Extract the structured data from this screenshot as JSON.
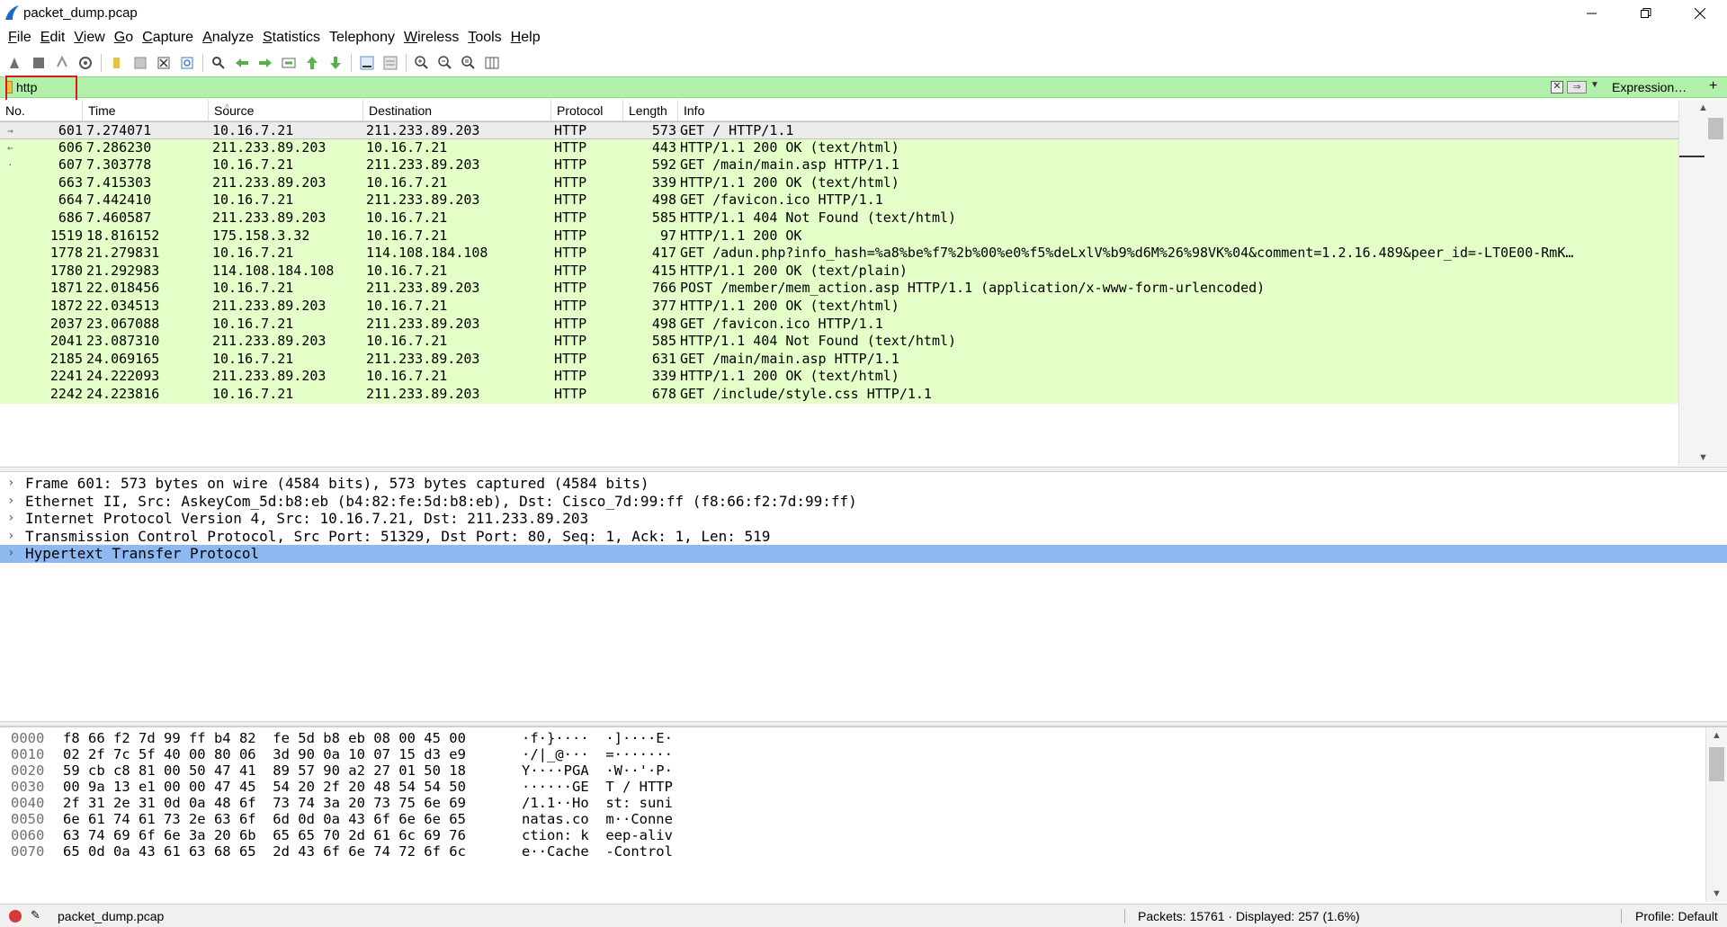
{
  "window": {
    "title": "packet_dump.pcap"
  },
  "menu": [
    {
      "label": "File",
      "u": "F",
      "rest": "ile"
    },
    {
      "label": "Edit",
      "u": "E",
      "rest": "dit"
    },
    {
      "label": "View",
      "u": "V",
      "rest": "iew"
    },
    {
      "label": "Go",
      "u": "G",
      "rest": "o"
    },
    {
      "label": "Capture",
      "u": "C",
      "rest": "apture"
    },
    {
      "label": "Analyze",
      "u": "A",
      "rest": "nalyze"
    },
    {
      "label": "Statistics",
      "u": "S",
      "rest": "tatistics"
    },
    {
      "label": "Telephony",
      "u": "",
      "rest": "Telephony"
    },
    {
      "label": "Wireless",
      "u": "W",
      "rest": "ireless"
    },
    {
      "label": "Tools",
      "u": "T",
      "rest": "ools"
    },
    {
      "label": "Help",
      "u": "H",
      "rest": "elp"
    }
  ],
  "toolbar": [
    "start-capture-icon",
    "stop-capture-icon",
    "restart-capture-icon",
    "capture-options-icon",
    "open-file-icon",
    "save-file-icon",
    "close-file-icon",
    "reload-file-icon",
    "find-packet-icon",
    "go-back-icon",
    "go-forward-icon",
    "go-to-packet-icon",
    "go-first-icon",
    "go-last-icon",
    "auto-scroll-icon",
    "colorize-icon",
    "zoom-in-icon",
    "zoom-out-icon",
    "zoom-normal-icon",
    "resize-columns-icon"
  ],
  "filter": {
    "value": "http",
    "expression_label": "Expression…",
    "plus_label": "+"
  },
  "packet_list": {
    "headers": {
      "no": "No.",
      "time": "Time",
      "source": "Source",
      "destination": "Destination",
      "protocol": "Protocol",
      "length": "Length",
      "info": "Info"
    },
    "rows": [
      {
        "no": "601",
        "time": "7.274071",
        "src": "10.16.7.21",
        "dst": "211.233.89.203",
        "proto": "HTTP",
        "len": "573",
        "info": "GET / HTTP/1.1"
      },
      {
        "no": "606",
        "time": "7.286230",
        "src": "211.233.89.203",
        "dst": "10.16.7.21",
        "proto": "HTTP",
        "len": "443",
        "info": "HTTP/1.1 200 OK  (text/html)"
      },
      {
        "no": "607",
        "time": "7.303778",
        "src": "10.16.7.21",
        "dst": "211.233.89.203",
        "proto": "HTTP",
        "len": "592",
        "info": "GET /main/main.asp HTTP/1.1"
      },
      {
        "no": "663",
        "time": "7.415303",
        "src": "211.233.89.203",
        "dst": "10.16.7.21",
        "proto": "HTTP",
        "len": "339",
        "info": "HTTP/1.1 200 OK  (text/html)"
      },
      {
        "no": "664",
        "time": "7.442410",
        "src": "10.16.7.21",
        "dst": "211.233.89.203",
        "proto": "HTTP",
        "len": "498",
        "info": "GET /favicon.ico HTTP/1.1"
      },
      {
        "no": "686",
        "time": "7.460587",
        "src": "211.233.89.203",
        "dst": "10.16.7.21",
        "proto": "HTTP",
        "len": "585",
        "info": "HTTP/1.1 404 Not Found  (text/html)"
      },
      {
        "no": "1519",
        "time": "18.816152",
        "src": "175.158.3.32",
        "dst": "10.16.7.21",
        "proto": "HTTP",
        "len": "97",
        "info": "HTTP/1.1 200 OK"
      },
      {
        "no": "1778",
        "time": "21.279831",
        "src": "10.16.7.21",
        "dst": "114.108.184.108",
        "proto": "HTTP",
        "len": "417",
        "info": "GET /adun.php?info_hash=%a8%be%f7%2b%00%e0%f5%deLxlV%b9%d6M%26%98VK%04&comment=1.2.16.489&peer_id=-LT0E00-RmK…"
      },
      {
        "no": "1780",
        "time": "21.292983",
        "src": "114.108.184.108",
        "dst": "10.16.7.21",
        "proto": "HTTP",
        "len": "415",
        "info": "HTTP/1.1 200 OK  (text/plain)"
      },
      {
        "no": "1871",
        "time": "22.018456",
        "src": "10.16.7.21",
        "dst": "211.233.89.203",
        "proto": "HTTP",
        "len": "766",
        "info": "POST /member/mem_action.asp HTTP/1.1  (application/x-www-form-urlencoded)"
      },
      {
        "no": "1872",
        "time": "22.034513",
        "src": "211.233.89.203",
        "dst": "10.16.7.21",
        "proto": "HTTP",
        "len": "377",
        "info": "HTTP/1.1 200 OK  (text/html)"
      },
      {
        "no": "2037",
        "time": "23.067088",
        "src": "10.16.7.21",
        "dst": "211.233.89.203",
        "proto": "HTTP",
        "len": "498",
        "info": "GET /favicon.ico HTTP/1.1"
      },
      {
        "no": "2041",
        "time": "23.087310",
        "src": "211.233.89.203",
        "dst": "10.16.7.21",
        "proto": "HTTP",
        "len": "585",
        "info": "HTTP/1.1 404 Not Found  (text/html)"
      },
      {
        "no": "2185",
        "time": "24.069165",
        "src": "10.16.7.21",
        "dst": "211.233.89.203",
        "proto": "HTTP",
        "len": "631",
        "info": "GET /main/main.asp HTTP/1.1"
      },
      {
        "no": "2241",
        "time": "24.222093",
        "src": "211.233.89.203",
        "dst": "10.16.7.21",
        "proto": "HTTP",
        "len": "339",
        "info": "HTTP/1.1 200 OK  (text/html)"
      },
      {
        "no": "2242",
        "time": "24.223816",
        "src": "10.16.7.21",
        "dst": "211.233.89.203",
        "proto": "HTTP",
        "len": "678",
        "info": "GET /include/style.css HTTP/1.1"
      }
    ]
  },
  "details": [
    "Frame 601: 573 bytes on wire (4584 bits), 573 bytes captured (4584 bits)",
    "Ethernet II, Src: AskeyCom_5d:b8:eb (b4:82:fe:5d:b8:eb), Dst: Cisco_7d:99:ff (f8:66:f2:7d:99:ff)",
    "Internet Protocol Version 4, Src: 10.16.7.21, Dst: 211.233.89.203",
    "Transmission Control Protocol, Src Port: 51329, Dst Port: 80, Seq: 1, Ack: 1, Len: 519",
    "Hypertext Transfer Protocol"
  ],
  "bytes": [
    {
      "off": "0000",
      "hex": "f8 66 f2 7d 99 ff b4 82  fe 5d b8 eb 08 00 45 00",
      "ascii": "·f·}····  ·]····E·"
    },
    {
      "off": "0010",
      "hex": "02 2f 7c 5f 40 00 80 06  3d 90 0a 10 07 15 d3 e9",
      "ascii": "·/|_@···  =·······"
    },
    {
      "off": "0020",
      "hex": "59 cb c8 81 00 50 47 41  89 57 90 a2 27 01 50 18",
      "ascii": "Y····PGA  ·W··'·P·"
    },
    {
      "off": "0030",
      "hex": "00 9a 13 e1 00 00 47 45  54 20 2f 20 48 54 54 50",
      "ascii": "······GE  T / HTTP"
    },
    {
      "off": "0040",
      "hex": "2f 31 2e 31 0d 0a 48 6f  73 74 3a 20 73 75 6e 69",
      "ascii": "/1.1··Ho  st: suni"
    },
    {
      "off": "0050",
      "hex": "6e 61 74 61 73 2e 63 6f  6d 0d 0a 43 6f 6e 6e 65",
      "ascii": "natas.co  m··Conne"
    },
    {
      "off": "0060",
      "hex": "63 74 69 6f 6e 3a 20 6b  65 65 70 2d 61 6c 69 76",
      "ascii": "ction: k  eep-aliv"
    },
    {
      "off": "0070",
      "hex": "65 0d 0a 43 61 63 68 65  2d 43 6f 6e 74 72 6f 6c",
      "ascii": "e··Cache  -Control"
    }
  ],
  "status": {
    "file": "packet_dump.pcap",
    "packets": "Packets: 15761 · Displayed: 257 (1.6%)",
    "profile": "Profile: Default"
  },
  "colors": {
    "http_row": "#e4ffc7",
    "filter_valid": "#b0f0a8",
    "tree_selected": "#8db8f0"
  }
}
